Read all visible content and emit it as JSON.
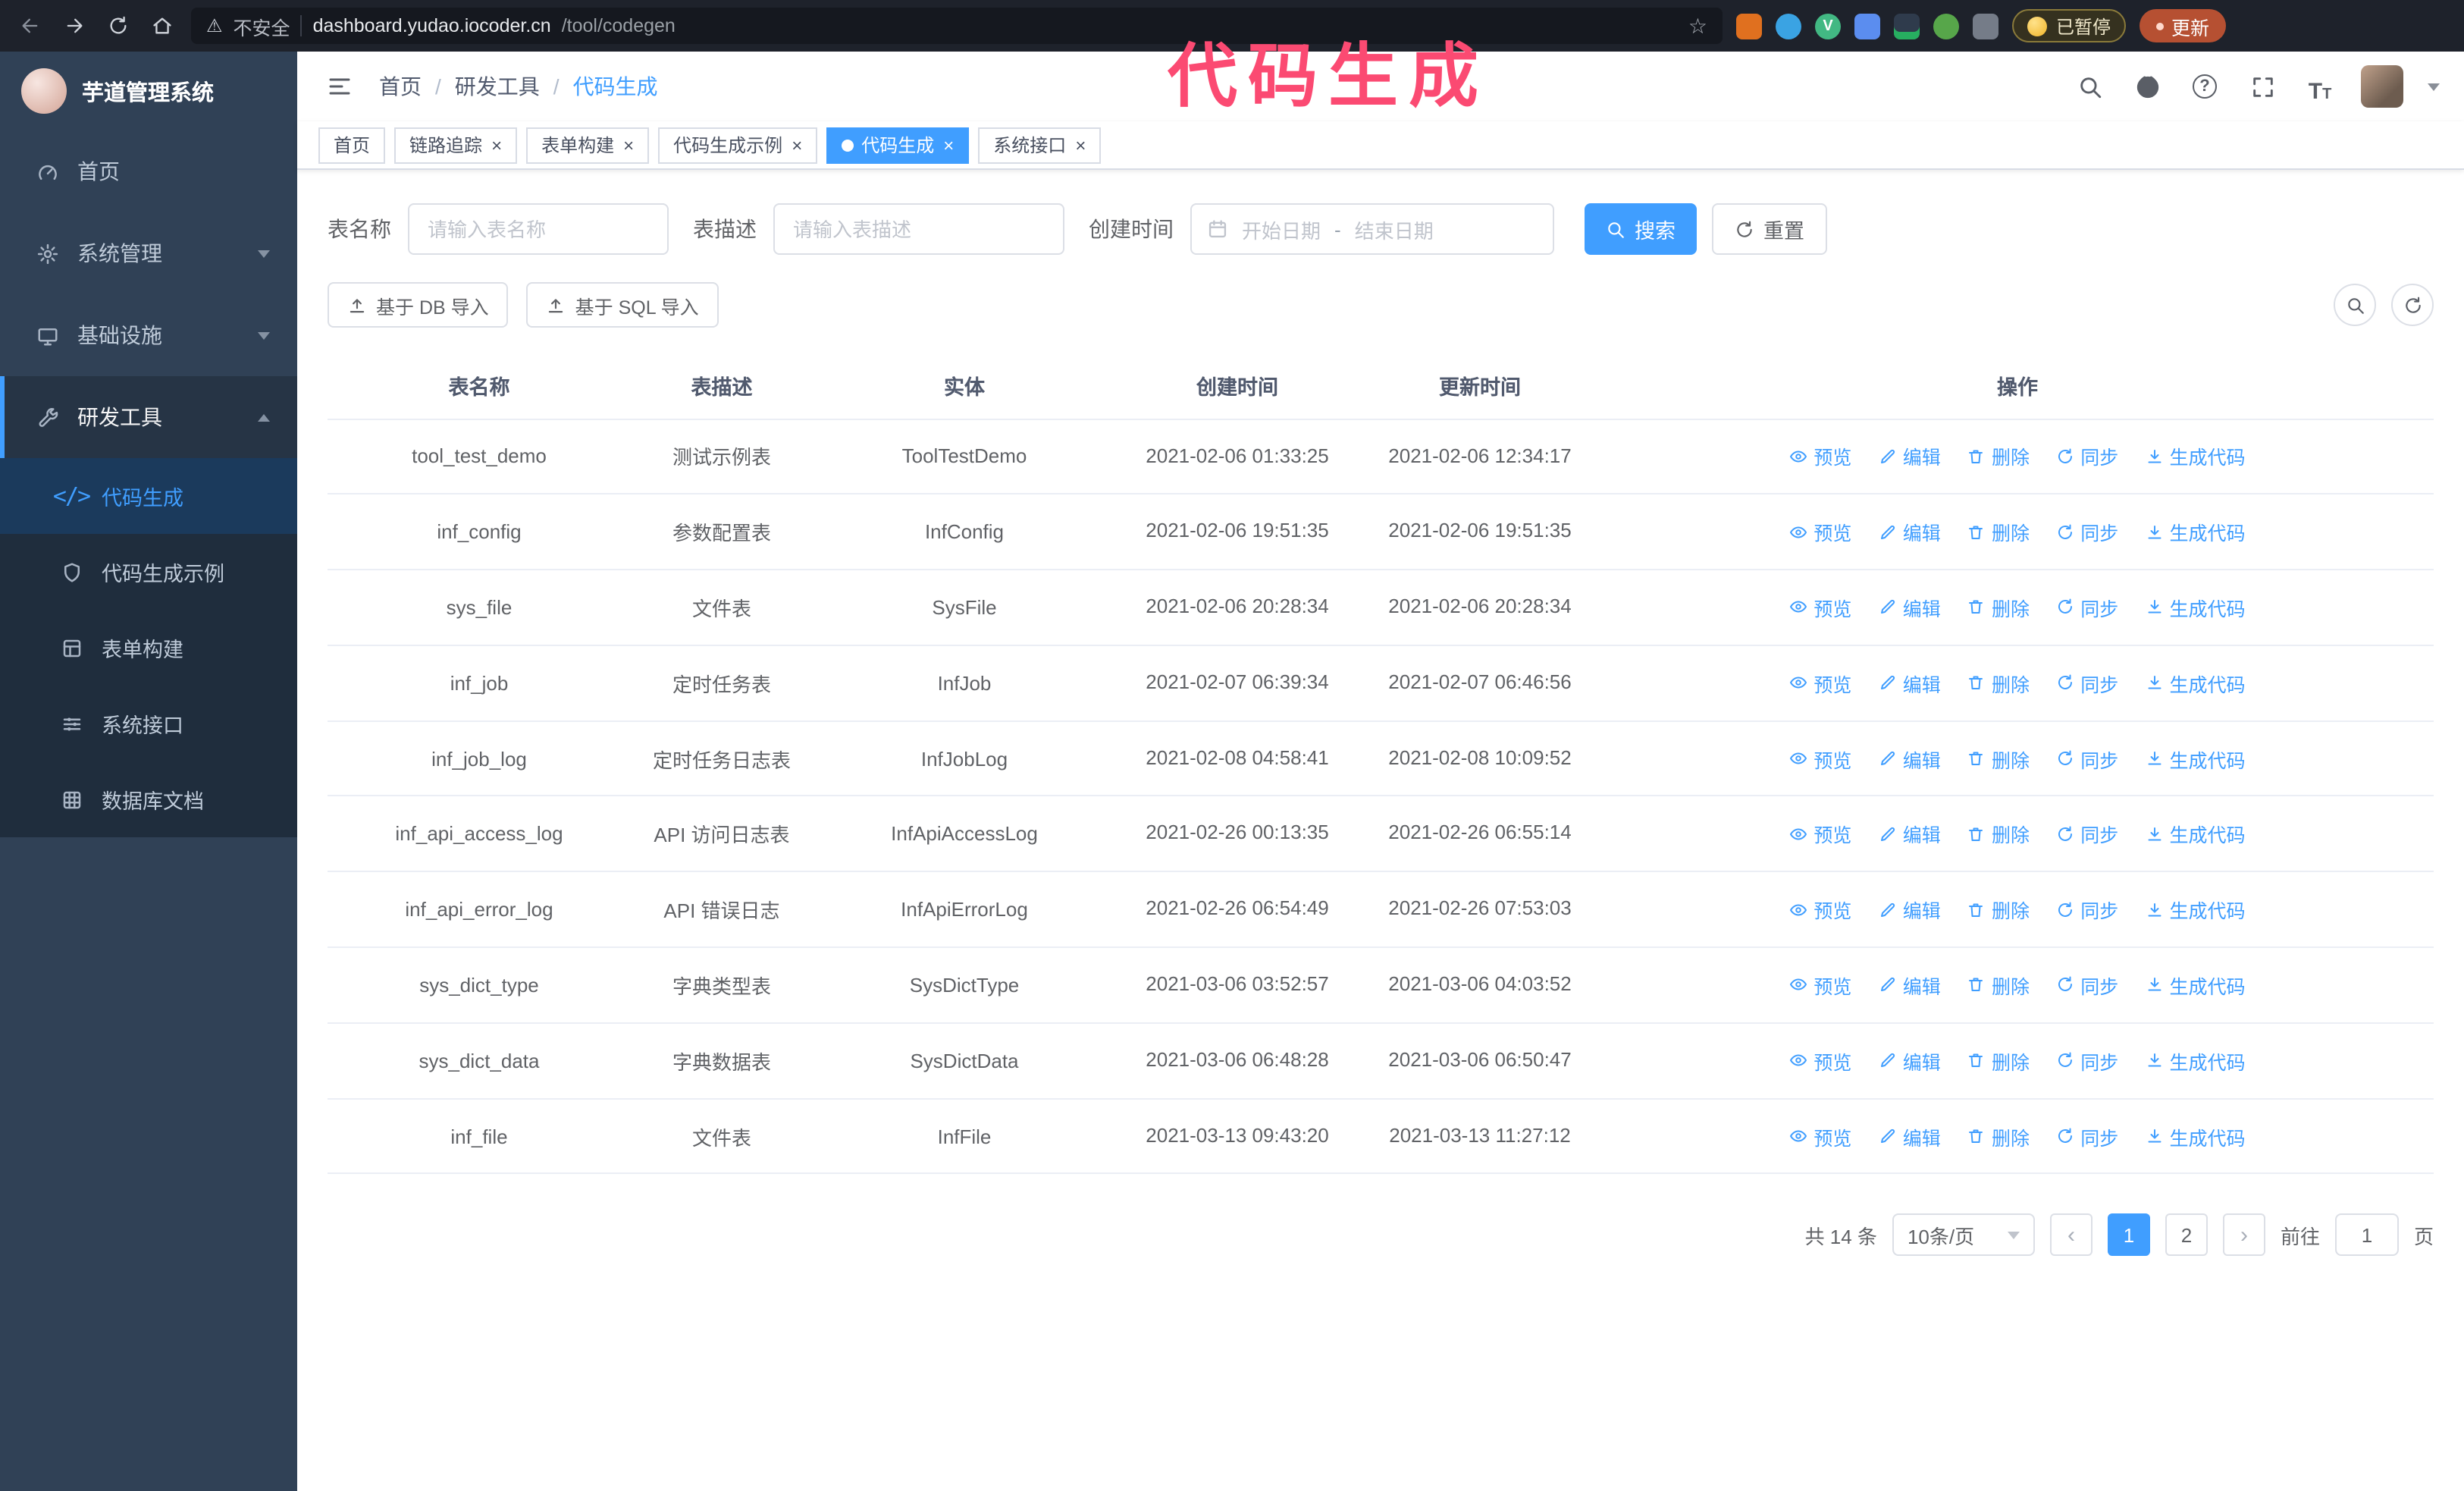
{
  "browser": {
    "security_label": "不安全",
    "url_host": "dashboard.yudao.iocoder.cn",
    "url_path": "/tool/codegen",
    "paused_badge": "已暂停",
    "update_button": "更新"
  },
  "annotation": {
    "text": "代码生成",
    "color": "#fb4a72"
  },
  "icons": {
    "warning": "⚠",
    "star": "☆",
    "close": "×",
    "prev": "‹",
    "next": "›",
    "question": "?",
    "code": "</>",
    "font_size": "T",
    "vue_letter": "V"
  },
  "sidebar": {
    "app_title": "芋道管理系统",
    "items": [
      {
        "label": "首页"
      },
      {
        "label": "系统管理"
      },
      {
        "label": "基础设施"
      },
      {
        "label": "研发工具"
      }
    ],
    "sub_items": [
      {
        "label": "代码生成"
      },
      {
        "label": "代码生成示例"
      },
      {
        "label": "表单构建"
      },
      {
        "label": "系统接口"
      },
      {
        "label": "数据库文档"
      }
    ]
  },
  "header": {
    "breadcrumb": [
      "首页",
      "研发工具",
      "代码生成"
    ]
  },
  "tabs": [
    {
      "label": "首页"
    },
    {
      "label": "链路追踪"
    },
    {
      "label": "表单构建"
    },
    {
      "label": "代码生成示例"
    },
    {
      "label": "代码生成"
    },
    {
      "label": "系统接口"
    }
  ],
  "filters": {
    "table_name_label": "表名称",
    "table_name_placeholder": "请输入表名称",
    "table_desc_label": "表描述",
    "table_desc_placeholder": "请输入表描述",
    "create_time_label": "创建时间",
    "start_placeholder": "开始日期",
    "range_separator": "-",
    "end_placeholder": "结束日期",
    "search_button": "搜索",
    "reset_button": "重置"
  },
  "toolbar": {
    "import_db": "基于 DB 导入",
    "import_sql": "基于 SQL 导入"
  },
  "table": {
    "columns": [
      "表名称",
      "表描述",
      "实体",
      "创建时间",
      "更新时间",
      "操作"
    ],
    "actions": [
      "预览",
      "编辑",
      "删除",
      "同步",
      "生成代码"
    ],
    "rows": [
      {
        "name": "tool_test_demo",
        "desc": "测试示例表",
        "entity": "ToolTestDemo",
        "created": "2021-02-06 01:33:25",
        "updated": "2021-02-06 12:34:17"
      },
      {
        "name": "inf_config",
        "desc": "参数配置表",
        "entity": "InfConfig",
        "created": "2021-02-06 19:51:35",
        "updated": "2021-02-06 19:51:35"
      },
      {
        "name": "sys_file",
        "desc": "文件表",
        "entity": "SysFile",
        "created": "2021-02-06 20:28:34",
        "updated": "2021-02-06 20:28:34"
      },
      {
        "name": "inf_job",
        "desc": "定时任务表",
        "entity": "InfJob",
        "created": "2021-02-07 06:39:34",
        "updated": "2021-02-07 06:46:56"
      },
      {
        "name": "inf_job_log",
        "desc": "定时任务日志表",
        "entity": "InfJobLog",
        "created": "2021-02-08 04:58:41",
        "updated": "2021-02-08 10:09:52"
      },
      {
        "name": "inf_api_access_log",
        "desc": "API 访问日志表",
        "entity": "InfApiAccessLog",
        "created": "2021-02-26 00:13:35",
        "updated": "2021-02-26 06:55:14"
      },
      {
        "name": "inf_api_error_log",
        "desc": "API 错误日志",
        "entity": "InfApiErrorLog",
        "created": "2021-02-26 06:54:49",
        "updated": "2021-02-26 07:53:03"
      },
      {
        "name": "sys_dict_type",
        "desc": "字典类型表",
        "entity": "SysDictType",
        "created": "2021-03-06 03:52:57",
        "updated": "2021-03-06 04:03:52"
      },
      {
        "name": "sys_dict_data",
        "desc": "字典数据表",
        "entity": "SysDictData",
        "created": "2021-03-06 06:48:28",
        "updated": "2021-03-06 06:50:47"
      },
      {
        "name": "inf_file",
        "desc": "文件表",
        "entity": "InfFile",
        "created": "2021-03-13 09:43:20",
        "updated": "2021-03-13 11:27:12"
      }
    ]
  },
  "pagination": {
    "total_text": "共 14 条",
    "page_size": "10条/页",
    "pages": [
      "1",
      "2"
    ],
    "active_page": "1",
    "goto_label": "前往",
    "goto_value": "1",
    "goto_suffix": "页"
  },
  "colors": {
    "accent": "#409EFF",
    "sidebar_bg": "#304156",
    "submenu_bg": "#1f2d3d",
    "annotation": "#fb4a72"
  }
}
